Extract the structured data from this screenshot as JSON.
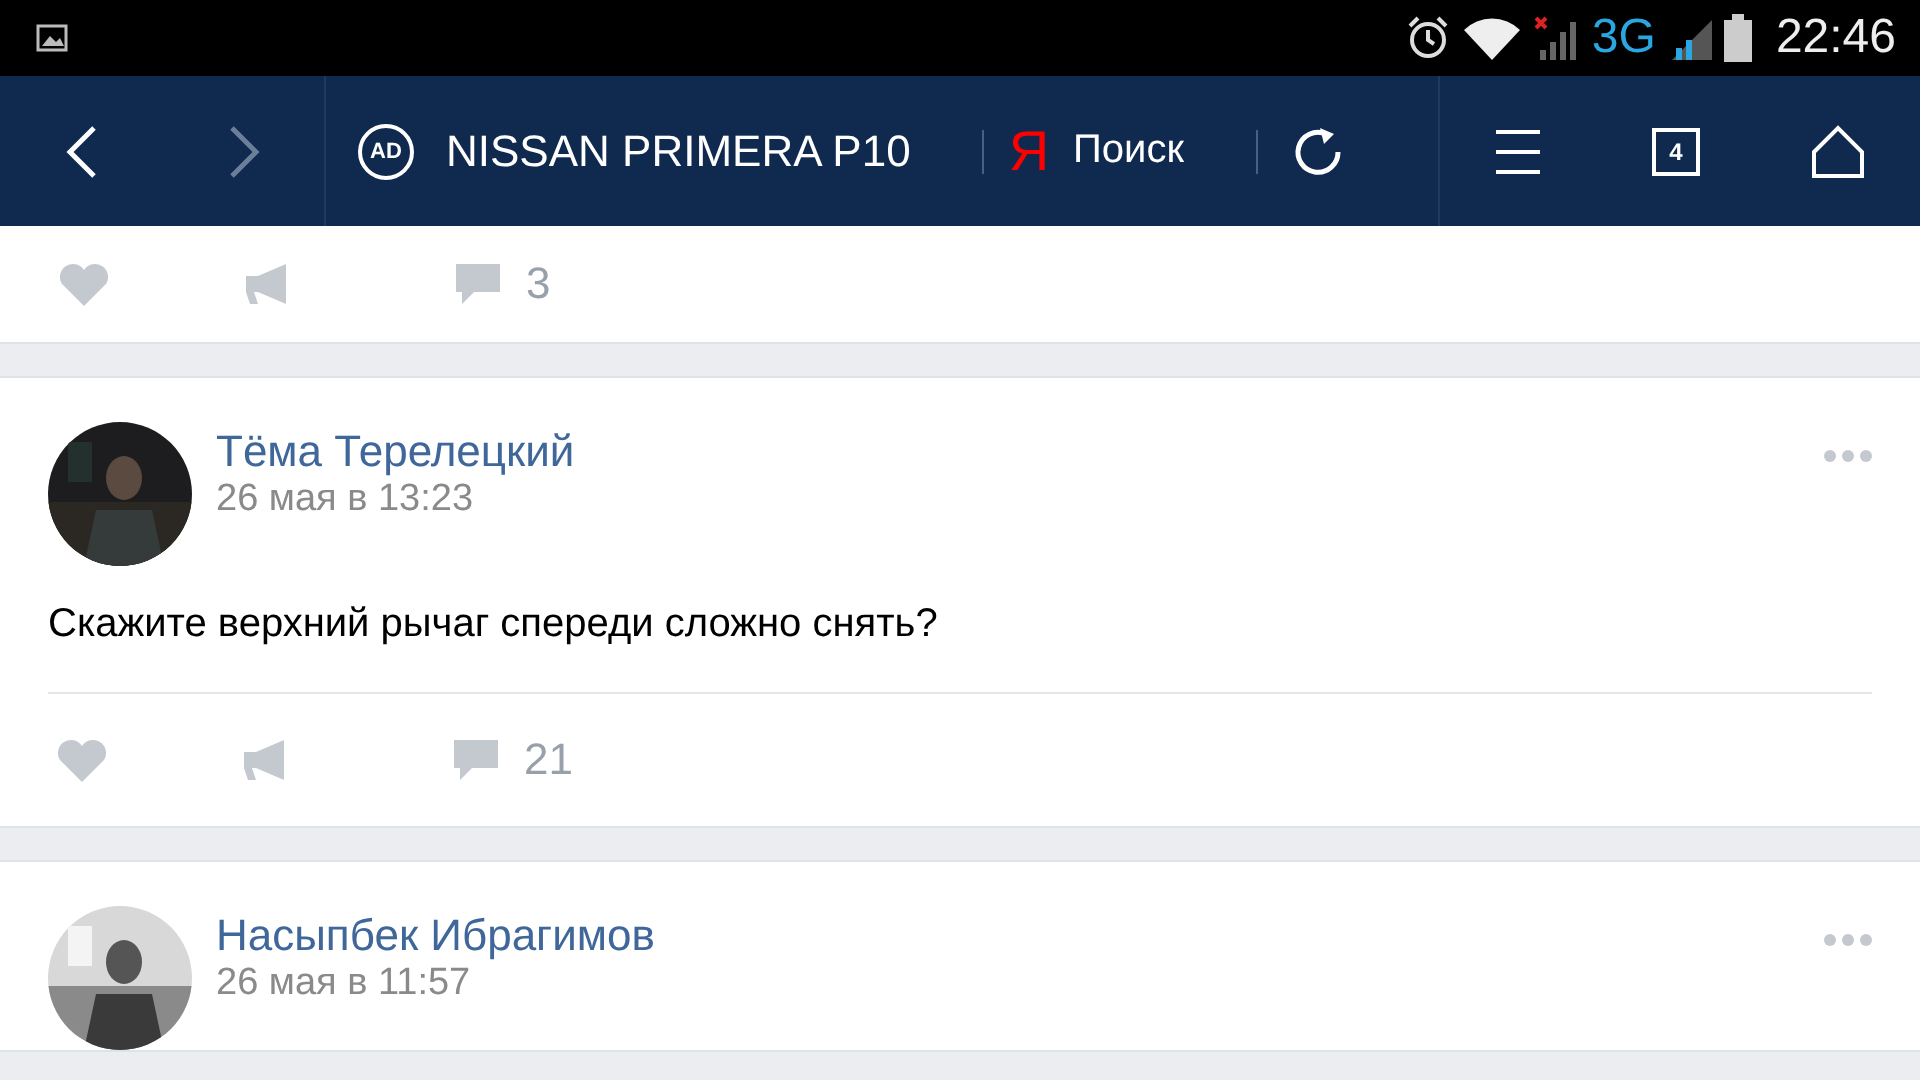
{
  "status_bar": {
    "network": "3G",
    "time": "22:46"
  },
  "toolbar": {
    "ad_badge": "AD",
    "page_title": "NISSAN PRIMERA P10",
    "search_logo": "Я",
    "search_label": "Поиск",
    "tab_count": "4"
  },
  "posts": [
    {
      "comments": "3"
    },
    {
      "author": "Тёма Терелецкий",
      "date": "26 мая в 13:23",
      "text": "Скажите верхний рычаг спереди сложно снять?",
      "comments": "21"
    },
    {
      "author": "Насыпбек Ибрагимов",
      "date": "26 мая в 11:57"
    }
  ]
}
